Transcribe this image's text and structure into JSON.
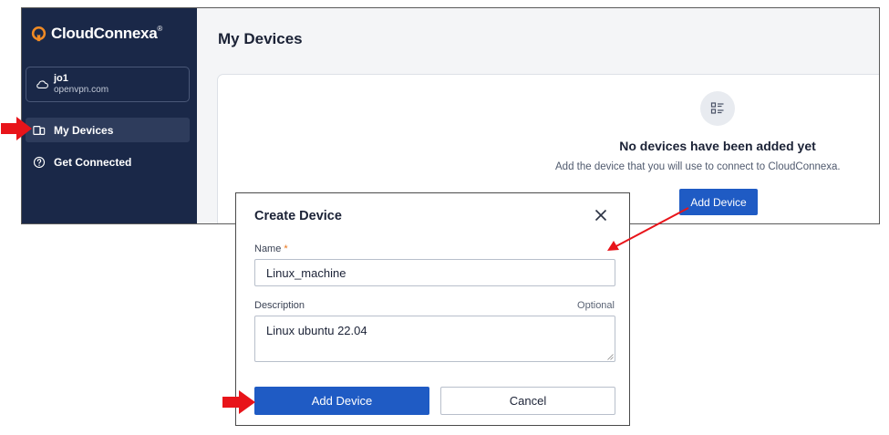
{
  "brand": {
    "name": "CloudConnexa",
    "mark": "®"
  },
  "org": {
    "name": "jo1",
    "domain": "openvpn.com"
  },
  "sidebar": {
    "items": [
      {
        "label": "My Devices",
        "active": true,
        "icon": "devices-icon"
      },
      {
        "label": "Get Connected",
        "active": false,
        "icon": "help-circle-icon"
      }
    ]
  },
  "main": {
    "title": "My Devices",
    "empty_state": {
      "icon": "list-icon",
      "title": "No devices have been added yet",
      "subtitle": "Add the device that you will use to connect to CloudConnexa.",
      "button_label": "Add Device"
    }
  },
  "dialog": {
    "title": "Create Device",
    "name_label": "Name",
    "required_mark": "*",
    "name_value": "Linux_machine",
    "description_label": "Description",
    "optional_label": "Optional",
    "description_value": "Linux ubuntu 22.04",
    "primary_button": "Add Device",
    "cancel_button": "Cancel"
  },
  "colors": {
    "sidebar_bg": "#1a2848",
    "accent": "#1f5bc4",
    "annotation_red": "#e8141a",
    "required_orange": "#e8741a"
  }
}
